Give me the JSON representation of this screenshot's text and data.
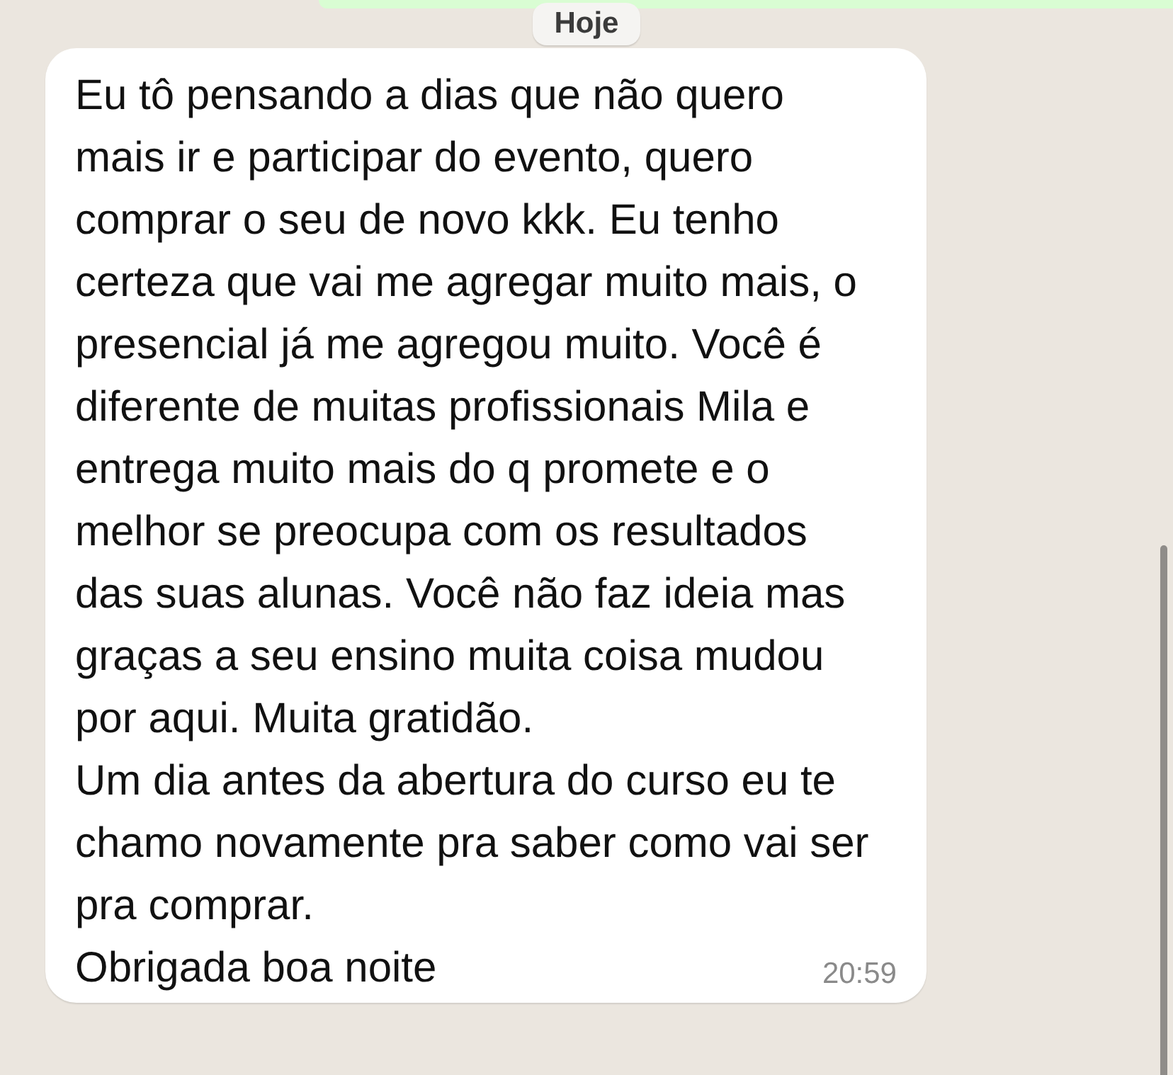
{
  "date_chip": "Hoje",
  "message": {
    "paragraphs": [
      "Eu tô pensando a dias que não quero mais ir e participar do evento, quero comprar o seu de novo kkk. Eu tenho certeza que vai me agregar muito mais, o presencial já me agregou muito. Você é diferente de muitas profissionais Mila e entrega muito mais do q promete e o melhor se preocupa com os resultados das suas alunas. Você não faz ideia mas graças a seu ensino muita coisa mudou por aqui. Muita gratidão.",
      "Um dia antes da abertura do curso eu te chamo novamente pra saber como vai ser pra comprar.",
      "Obrigada boa noite"
    ],
    "time": "20:59"
  }
}
